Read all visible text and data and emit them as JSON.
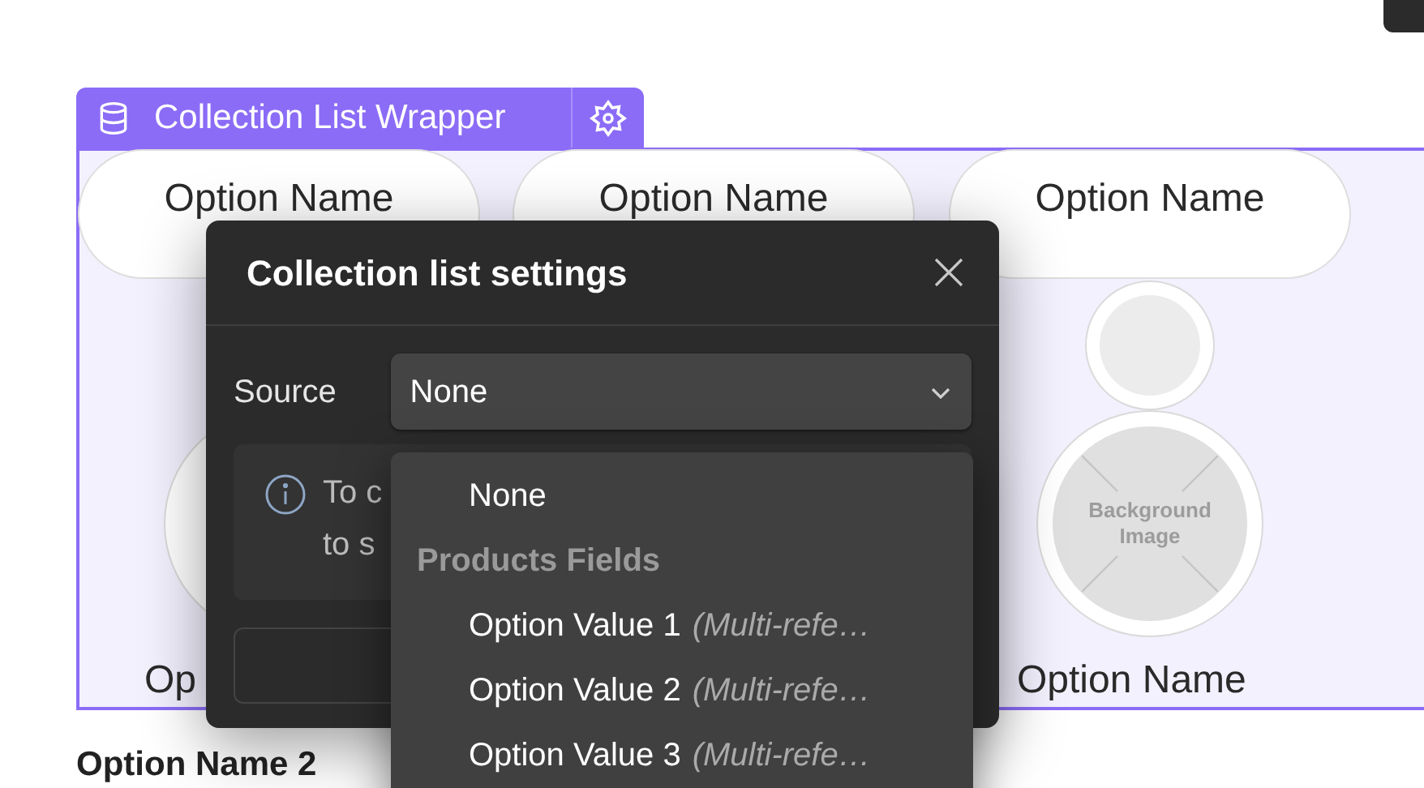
{
  "canvas": {
    "wrapper_label": "Collection List Wrapper",
    "pills": [
      "Option Name",
      "Option Name",
      "Option Name"
    ],
    "image_placeholder": "Background Image",
    "captions": [
      "Op",
      "Option Name"
    ],
    "below_heading": "Option Name 2"
  },
  "dialog": {
    "title": "Collection list settings",
    "source_label": "Source",
    "source_value": "None",
    "info_lines": [
      "To c",
      "to s"
    ]
  },
  "dropdown": {
    "items": [
      {
        "kind": "option",
        "label": "None"
      },
      {
        "kind": "group",
        "label": "Products Fields"
      },
      {
        "kind": "option",
        "label": "Option Value 1",
        "type": "(Multi-refe…"
      },
      {
        "kind": "option",
        "label": "Option Value 2",
        "type": "(Multi-refe…"
      },
      {
        "kind": "option",
        "label": "Option Value 3",
        "type": "(Multi-refe…"
      }
    ]
  }
}
